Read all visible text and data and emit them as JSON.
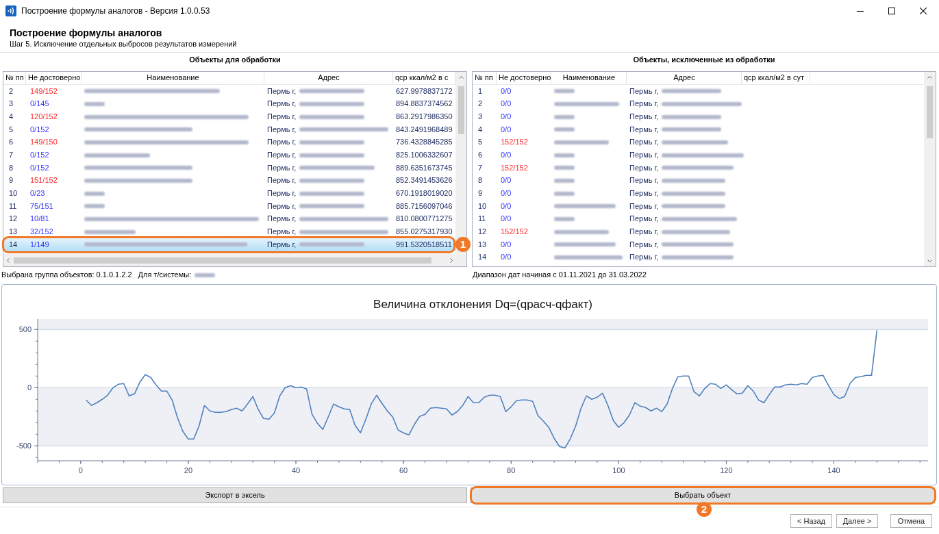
{
  "window": {
    "title": "Построение формулы аналогов - Версия 1.0.0.53"
  },
  "header": {
    "title": "Построение формулы аналогов",
    "subtitle": "Шаг 5. Исключение отдельных выбросов результатов измерений"
  },
  "left_table": {
    "title": "Объекты для обработки",
    "columns": [
      "№ пп",
      "Не достоверно",
      "Наименование",
      "Адрес",
      "qср ккал/м2 в с"
    ],
    "rows": [
      {
        "number": "2",
        "count": "149/152",
        "flagged": true,
        "address": "Пермь г,",
        "value": "627.9978837172",
        "selected": false
      },
      {
        "number": "3",
        "count": "0/145",
        "flagged": false,
        "address": "Пермь г,",
        "value": "894.8837374562",
        "selected": false
      },
      {
        "number": "4",
        "count": "120/152",
        "flagged": true,
        "address": "Пермь г,",
        "value": "863.2917986350",
        "selected": false
      },
      {
        "number": "5",
        "count": "0/152",
        "flagged": false,
        "address": "Пермь г,",
        "value": "843.2491968489",
        "selected": false
      },
      {
        "number": "6",
        "count": "149/150",
        "flagged": true,
        "address": "Пермь г,",
        "value": "736.4328845285",
        "selected": false
      },
      {
        "number": "7",
        "count": "0/152",
        "flagged": false,
        "address": "Пермь г,",
        "value": "825.1006332607",
        "selected": false
      },
      {
        "number": "8",
        "count": "0/152",
        "flagged": false,
        "address": "Пермь г,",
        "value": "889.6351673745",
        "selected": false
      },
      {
        "number": "9",
        "count": "151/152",
        "flagged": true,
        "address": "Пермь г,",
        "value": "852.3491453626",
        "selected": false
      },
      {
        "number": "10",
        "count": "0/23",
        "flagged": false,
        "address": "Пермь г,",
        "value": "670.1918019020",
        "selected": false
      },
      {
        "number": "11",
        "count": "75/151",
        "flagged": false,
        "address": "Пермь г,",
        "value": "885.7156097046",
        "selected": false
      },
      {
        "number": "12",
        "count": "10/81",
        "flagged": false,
        "address": "Пермь г,",
        "value": "810.0800771275",
        "selected": false
      },
      {
        "number": "13",
        "count": "32/152",
        "flagged": false,
        "address": "Пермь г,",
        "value": "855.0275317930",
        "selected": false
      },
      {
        "number": "14",
        "count": "1/149",
        "flagged": false,
        "address": "Пермь г,",
        "value": "991.5320518511",
        "selected": true,
        "callout": "1"
      }
    ]
  },
  "right_table": {
    "title": "Объекты, исключенные из обработки",
    "columns": [
      "№ пп",
      "Не достоверно",
      "Наименование",
      "Адрес",
      "qср ккал/м2 в сут"
    ],
    "rows": [
      {
        "number": "1",
        "count": "0/0",
        "flagged": false,
        "address": "Пермь г,",
        "selected": false
      },
      {
        "number": "2",
        "count": "0/0",
        "flagged": false,
        "address": "Пермь г,",
        "selected": false
      },
      {
        "number": "3",
        "count": "0/0",
        "flagged": false,
        "address": "Пермь г,",
        "selected": false
      },
      {
        "number": "4",
        "count": "0/0",
        "flagged": false,
        "address": "Пермь г,",
        "selected": false
      },
      {
        "number": "5",
        "count": "152/152",
        "flagged": true,
        "address": "Пермь г,",
        "selected": false
      },
      {
        "number": "6",
        "count": "0/0",
        "flagged": false,
        "address": "Пермь г,",
        "selected": false
      },
      {
        "number": "7",
        "count": "152/152",
        "flagged": true,
        "address": "Пермь г,",
        "selected": false
      },
      {
        "number": "8",
        "count": "0/0",
        "flagged": false,
        "address": "Пермь г,",
        "selected": false
      },
      {
        "number": "9",
        "count": "0/0",
        "flagged": false,
        "address": "Пермь г,",
        "selected": false
      },
      {
        "number": "10",
        "count": "0/0",
        "flagged": false,
        "address": "Пермь г,",
        "selected": false
      },
      {
        "number": "11",
        "count": "0/0",
        "flagged": false,
        "address": "Пермь г,",
        "selected": false
      },
      {
        "number": "12",
        "count": "152/152",
        "flagged": true,
        "address": "Пермь г,",
        "selected": false
      },
      {
        "number": "13",
        "count": "0/0",
        "flagged": false,
        "address": "Пермь г,",
        "selected": false
      },
      {
        "number": "14",
        "count": "0/0",
        "flagged": false,
        "address": "Пермь г,",
        "selected": false
      }
    ]
  },
  "status": {
    "group": "Выбрана группа объектов: 0.1.0.1.2.2",
    "system_label": "Для т/системы:",
    "date_range": "Диапазон дат начиная с 01.11.2021 до 31.03.2022"
  },
  "chart": {
    "chart_data": {
      "type": "line",
      "title": "Величина отклонения Dq=(qрасч-qфакт)",
      "x": [
        1,
        2,
        3,
        4,
        5,
        6,
        7,
        8,
        9,
        10,
        11,
        12,
        13,
        14,
        15,
        16,
        17,
        18,
        19,
        20,
        21,
        22,
        23,
        24,
        25,
        26,
        27,
        28,
        29,
        30,
        31,
        32,
        33,
        34,
        35,
        36,
        37,
        38,
        39,
        40,
        41,
        42,
        43,
        44,
        45,
        46,
        47,
        48,
        49,
        50,
        51,
        52,
        53,
        54,
        55,
        56,
        57,
        58,
        59,
        60,
        61,
        62,
        63,
        64,
        65,
        66,
        67,
        68,
        69,
        70,
        71,
        72,
        73,
        74,
        75,
        76,
        77,
        78,
        79,
        80,
        81,
        82,
        83,
        84,
        85,
        86,
        87,
        88,
        89,
        90,
        91,
        92,
        93,
        94,
        95,
        96,
        97,
        98,
        99,
        100,
        101,
        102,
        103,
        104,
        105,
        106,
        107,
        108,
        109,
        110,
        111,
        112,
        113,
        114,
        115,
        116,
        117,
        118,
        119,
        120,
        121,
        122,
        123,
        124,
        125,
        126,
        127,
        128,
        129,
        130,
        131,
        132,
        133,
        134,
        135,
        136,
        137,
        138,
        139,
        140,
        141,
        142,
        143,
        144,
        145,
        146,
        147,
        148
      ],
      "series": [
        {
          "color": "#4f81bd",
          "values": [
            -106,
            -153,
            -129,
            -100,
            -65,
            0,
            29,
            35,
            -71,
            -53,
            47,
            112,
            88,
            24,
            -29,
            -29,
            -106,
            -259,
            -376,
            -441,
            -441,
            -329,
            -153,
            -200,
            -212,
            -212,
            -206,
            -188,
            -176,
            -200,
            -141,
            -76,
            -188,
            -265,
            -270,
            -218,
            -71,
            0,
            18,
            0,
            6,
            -12,
            -229,
            -306,
            -359,
            -253,
            -141,
            -165,
            -182,
            -188,
            -323,
            -388,
            -270,
            -141,
            -65,
            -135,
            -200,
            -253,
            -365,
            -388,
            -406,
            -318,
            -247,
            -229,
            -176,
            -171,
            -176,
            -182,
            -235,
            -206,
            -153,
            -76,
            -129,
            -129,
            -82,
            -65,
            -65,
            -76,
            -206,
            -165,
            -112,
            -106,
            -106,
            -118,
            -241,
            -288,
            -341,
            -435,
            -506,
            -518,
            -441,
            -329,
            -176,
            -71,
            -100,
            -82,
            -47,
            -153,
            -282,
            -341,
            -300,
            -235,
            -129,
            -159,
            -171,
            -200,
            -176,
            -206,
            -141,
            -6,
            94,
            100,
            100,
            -35,
            -71,
            -6,
            35,
            29,
            -6,
            24,
            -18,
            -53,
            -47,
            18,
            -29,
            -106,
            -129,
            -59,
            6,
            6,
            24,
            29,
            24,
            35,
            29,
            88,
            100,
            106,
            18,
            -59,
            -94,
            -76,
            35,
            88,
            94,
            106,
            106,
            494
          ]
        }
      ],
      "xlim": [
        -8,
        157.5
      ],
      "ylim": [
        -628,
        590
      ],
      "xticks": [
        0,
        20,
        40,
        60,
        80,
        100,
        120,
        140
      ],
      "yticks": [
        -500,
        0,
        500
      ],
      "grid": true
    }
  },
  "actions": [
    {
      "label": "Экспорт в эксель"
    },
    {
      "label": "Выбрать объект",
      "callout": "2"
    }
  ],
  "footer_buttons": [
    {
      "label": "< Назад"
    },
    {
      "label": "Далее >"
    },
    {
      "label": "Отмена"
    }
  ]
}
